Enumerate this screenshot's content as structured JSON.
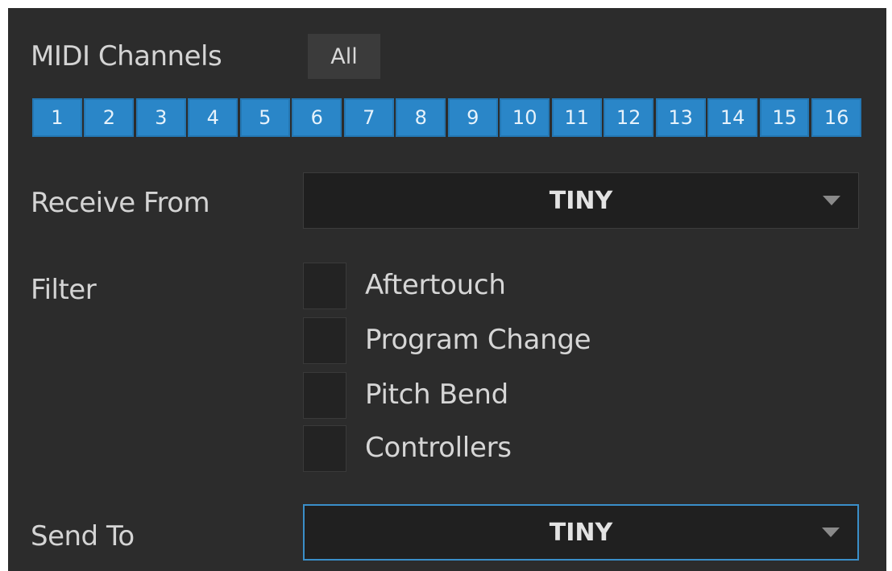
{
  "midi_channels": {
    "label": "MIDI Channels",
    "all_label": "All",
    "channels": [
      "1",
      "2",
      "3",
      "4",
      "5",
      "6",
      "7",
      "8",
      "9",
      "10",
      "11",
      "12",
      "13",
      "14",
      "15",
      "16"
    ],
    "selected_color": "#2a86c8"
  },
  "receive_from": {
    "label": "Receive From",
    "value": "TINY"
  },
  "filter": {
    "label": "Filter",
    "options": [
      {
        "label": "Aftertouch",
        "checked": false
      },
      {
        "label": "Program Change",
        "checked": false
      },
      {
        "label": "Pitch Bend",
        "checked": false
      },
      {
        "label": "Controllers",
        "checked": false
      }
    ]
  },
  "send_to": {
    "label": "Send To",
    "value": "TINY"
  }
}
